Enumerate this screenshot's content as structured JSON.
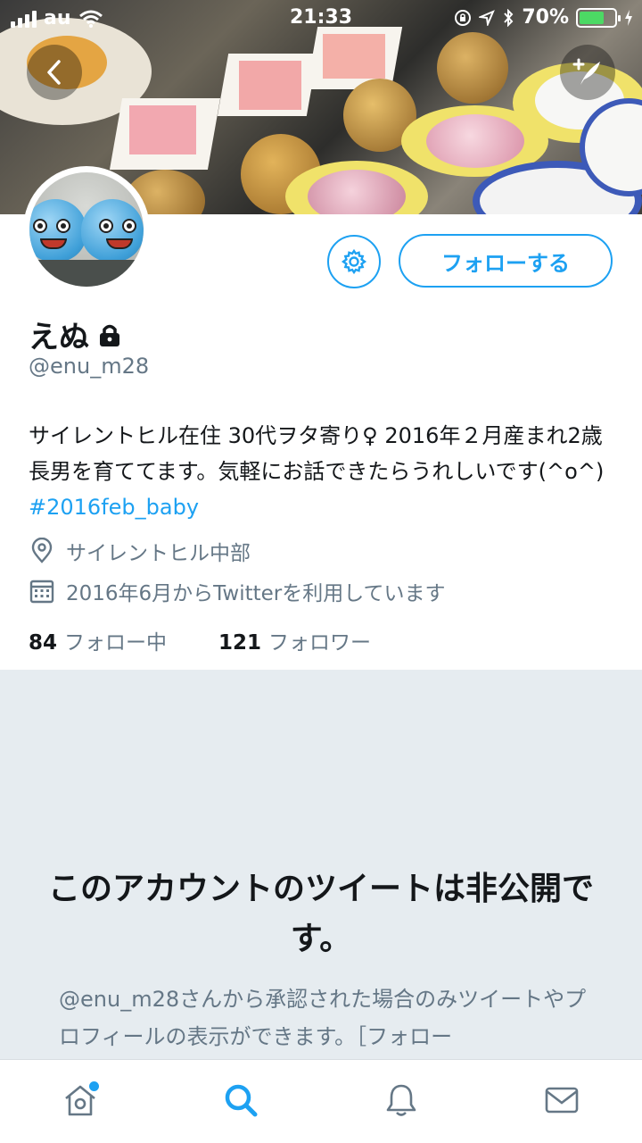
{
  "status_bar": {
    "carrier": "au",
    "time": "21:33",
    "battery_percent": "70%",
    "battery_level": 0.7
  },
  "profile": {
    "display_name": "えぬ",
    "handle": "@enu_m28",
    "bio_text": "サイレントヒル在住 30代ヲタ寄り♀ 2016年２月産まれ2歳長男を育ててます。気軽にお話できたらうれしいです(^o^) ",
    "bio_hashtag": "#2016feb_baby",
    "location": "サイレントヒル中部",
    "joined": "2016年6月からTwitterを利用しています",
    "following_count": "84",
    "following_label": "フォロー中",
    "followers_count": "121",
    "followers_label": "フォロワー"
  },
  "actions": {
    "follow_label": "フォローする"
  },
  "protected": {
    "title": "このアカウントのツイートは非公開です。",
    "body": "@enu_m28さんから承認された場合のみツイートやプロフィールの表示ができます。［フォロー"
  },
  "colors": {
    "accent": "#1da1f2",
    "secondary_text": "#657786",
    "protected_bg": "#e6ecf0"
  },
  "icons": [
    "back-icon",
    "compose-icon",
    "gear-icon",
    "lock-icon",
    "location-icon",
    "calendar-icon",
    "home-icon",
    "search-icon",
    "bell-icon",
    "mail-icon"
  ]
}
